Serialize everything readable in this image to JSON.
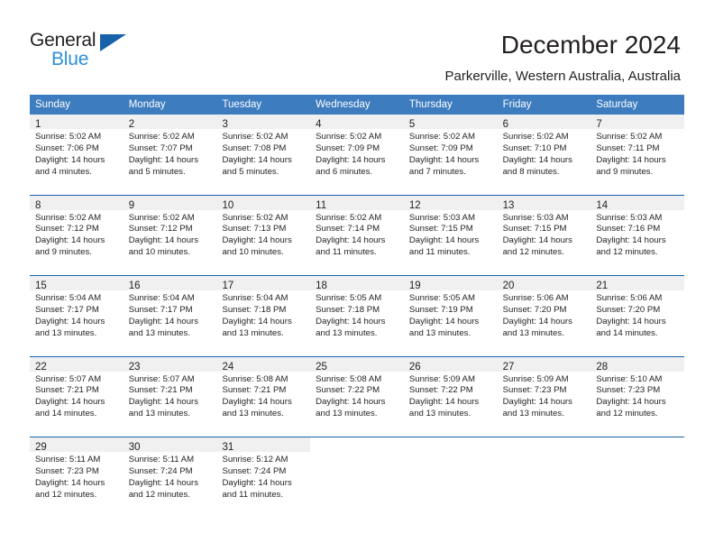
{
  "brand": {
    "name_part1": "General",
    "name_part2": "Blue",
    "flag_icon": "triangle-flag-icon"
  },
  "header": {
    "title": "December 2024",
    "location": "Parkerville, Western Australia, Australia"
  },
  "colors": {
    "header_blue": "#3c7cbf",
    "rule_blue": "#1862ab",
    "day_band_gray": "#f0f0f0",
    "brand_blue": "#2d8fd5",
    "text": "#231f20"
  },
  "weekdays": [
    "Sunday",
    "Monday",
    "Tuesday",
    "Wednesday",
    "Thursday",
    "Friday",
    "Saturday"
  ],
  "labels": {
    "sunrise": "Sunrise:",
    "sunset": "Sunset:",
    "daylight": "Daylight:"
  },
  "weeks": [
    [
      {
        "day": "1",
        "sunrise": "Sunrise: 5:02 AM",
        "sunset": "Sunset: 7:06 PM",
        "daylight_1": "Daylight: 14 hours",
        "daylight_2": "and 4 minutes."
      },
      {
        "day": "2",
        "sunrise": "Sunrise: 5:02 AM",
        "sunset": "Sunset: 7:07 PM",
        "daylight_1": "Daylight: 14 hours",
        "daylight_2": "and 5 minutes."
      },
      {
        "day": "3",
        "sunrise": "Sunrise: 5:02 AM",
        "sunset": "Sunset: 7:08 PM",
        "daylight_1": "Daylight: 14 hours",
        "daylight_2": "and 5 minutes."
      },
      {
        "day": "4",
        "sunrise": "Sunrise: 5:02 AM",
        "sunset": "Sunset: 7:09 PM",
        "daylight_1": "Daylight: 14 hours",
        "daylight_2": "and 6 minutes."
      },
      {
        "day": "5",
        "sunrise": "Sunrise: 5:02 AM",
        "sunset": "Sunset: 7:09 PM",
        "daylight_1": "Daylight: 14 hours",
        "daylight_2": "and 7 minutes."
      },
      {
        "day": "6",
        "sunrise": "Sunrise: 5:02 AM",
        "sunset": "Sunset: 7:10 PM",
        "daylight_1": "Daylight: 14 hours",
        "daylight_2": "and 8 minutes."
      },
      {
        "day": "7",
        "sunrise": "Sunrise: 5:02 AM",
        "sunset": "Sunset: 7:11 PM",
        "daylight_1": "Daylight: 14 hours",
        "daylight_2": "and 9 minutes."
      }
    ],
    [
      {
        "day": "8",
        "sunrise": "Sunrise: 5:02 AM",
        "sunset": "Sunset: 7:12 PM",
        "daylight_1": "Daylight: 14 hours",
        "daylight_2": "and 9 minutes."
      },
      {
        "day": "9",
        "sunrise": "Sunrise: 5:02 AM",
        "sunset": "Sunset: 7:12 PM",
        "daylight_1": "Daylight: 14 hours",
        "daylight_2": "and 10 minutes."
      },
      {
        "day": "10",
        "sunrise": "Sunrise: 5:02 AM",
        "sunset": "Sunset: 7:13 PM",
        "daylight_1": "Daylight: 14 hours",
        "daylight_2": "and 10 minutes."
      },
      {
        "day": "11",
        "sunrise": "Sunrise: 5:02 AM",
        "sunset": "Sunset: 7:14 PM",
        "daylight_1": "Daylight: 14 hours",
        "daylight_2": "and 11 minutes."
      },
      {
        "day": "12",
        "sunrise": "Sunrise: 5:03 AM",
        "sunset": "Sunset: 7:15 PM",
        "daylight_1": "Daylight: 14 hours",
        "daylight_2": "and 11 minutes."
      },
      {
        "day": "13",
        "sunrise": "Sunrise: 5:03 AM",
        "sunset": "Sunset: 7:15 PM",
        "daylight_1": "Daylight: 14 hours",
        "daylight_2": "and 12 minutes."
      },
      {
        "day": "14",
        "sunrise": "Sunrise: 5:03 AM",
        "sunset": "Sunset: 7:16 PM",
        "daylight_1": "Daylight: 14 hours",
        "daylight_2": "and 12 minutes."
      }
    ],
    [
      {
        "day": "15",
        "sunrise": "Sunrise: 5:04 AM",
        "sunset": "Sunset: 7:17 PM",
        "daylight_1": "Daylight: 14 hours",
        "daylight_2": "and 13 minutes."
      },
      {
        "day": "16",
        "sunrise": "Sunrise: 5:04 AM",
        "sunset": "Sunset: 7:17 PM",
        "daylight_1": "Daylight: 14 hours",
        "daylight_2": "and 13 minutes."
      },
      {
        "day": "17",
        "sunrise": "Sunrise: 5:04 AM",
        "sunset": "Sunset: 7:18 PM",
        "daylight_1": "Daylight: 14 hours",
        "daylight_2": "and 13 minutes."
      },
      {
        "day": "18",
        "sunrise": "Sunrise: 5:05 AM",
        "sunset": "Sunset: 7:18 PM",
        "daylight_1": "Daylight: 14 hours",
        "daylight_2": "and 13 minutes."
      },
      {
        "day": "19",
        "sunrise": "Sunrise: 5:05 AM",
        "sunset": "Sunset: 7:19 PM",
        "daylight_1": "Daylight: 14 hours",
        "daylight_2": "and 13 minutes."
      },
      {
        "day": "20",
        "sunrise": "Sunrise: 5:06 AM",
        "sunset": "Sunset: 7:20 PM",
        "daylight_1": "Daylight: 14 hours",
        "daylight_2": "and 13 minutes."
      },
      {
        "day": "21",
        "sunrise": "Sunrise: 5:06 AM",
        "sunset": "Sunset: 7:20 PM",
        "daylight_1": "Daylight: 14 hours",
        "daylight_2": "and 14 minutes."
      }
    ],
    [
      {
        "day": "22",
        "sunrise": "Sunrise: 5:07 AM",
        "sunset": "Sunset: 7:21 PM",
        "daylight_1": "Daylight: 14 hours",
        "daylight_2": "and 14 minutes."
      },
      {
        "day": "23",
        "sunrise": "Sunrise: 5:07 AM",
        "sunset": "Sunset: 7:21 PM",
        "daylight_1": "Daylight: 14 hours",
        "daylight_2": "and 13 minutes."
      },
      {
        "day": "24",
        "sunrise": "Sunrise: 5:08 AM",
        "sunset": "Sunset: 7:21 PM",
        "daylight_1": "Daylight: 14 hours",
        "daylight_2": "and 13 minutes."
      },
      {
        "day": "25",
        "sunrise": "Sunrise: 5:08 AM",
        "sunset": "Sunset: 7:22 PM",
        "daylight_1": "Daylight: 14 hours",
        "daylight_2": "and 13 minutes."
      },
      {
        "day": "26",
        "sunrise": "Sunrise: 5:09 AM",
        "sunset": "Sunset: 7:22 PM",
        "daylight_1": "Daylight: 14 hours",
        "daylight_2": "and 13 minutes."
      },
      {
        "day": "27",
        "sunrise": "Sunrise: 5:09 AM",
        "sunset": "Sunset: 7:23 PM",
        "daylight_1": "Daylight: 14 hours",
        "daylight_2": "and 13 minutes."
      },
      {
        "day": "28",
        "sunrise": "Sunrise: 5:10 AM",
        "sunset": "Sunset: 7:23 PM",
        "daylight_1": "Daylight: 14 hours",
        "daylight_2": "and 12 minutes."
      }
    ],
    [
      {
        "day": "29",
        "sunrise": "Sunrise: 5:11 AM",
        "sunset": "Sunset: 7:23 PM",
        "daylight_1": "Daylight: 14 hours",
        "daylight_2": "and 12 minutes."
      },
      {
        "day": "30",
        "sunrise": "Sunrise: 5:11 AM",
        "sunset": "Sunset: 7:24 PM",
        "daylight_1": "Daylight: 14 hours",
        "daylight_2": "and 12 minutes."
      },
      {
        "day": "31",
        "sunrise": "Sunrise: 5:12 AM",
        "sunset": "Sunset: 7:24 PM",
        "daylight_1": "Daylight: 14 hours",
        "daylight_2": "and 11 minutes."
      },
      {
        "day": "",
        "sunrise": "",
        "sunset": "",
        "daylight_1": "",
        "daylight_2": ""
      },
      {
        "day": "",
        "sunrise": "",
        "sunset": "",
        "daylight_1": "",
        "daylight_2": ""
      },
      {
        "day": "",
        "sunrise": "",
        "sunset": "",
        "daylight_1": "",
        "daylight_2": ""
      },
      {
        "day": "",
        "sunrise": "",
        "sunset": "",
        "daylight_1": "",
        "daylight_2": ""
      }
    ]
  ]
}
